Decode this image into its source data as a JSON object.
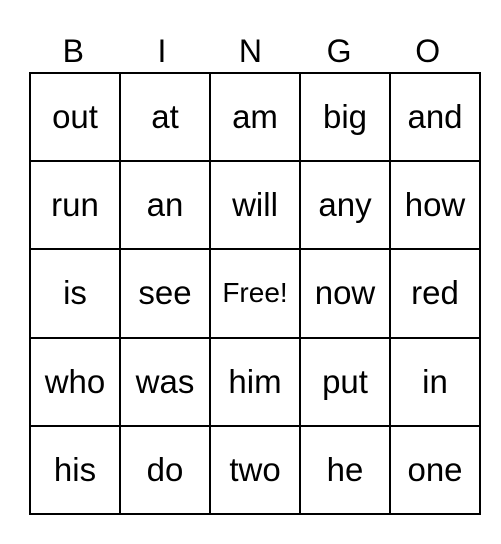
{
  "header": [
    "B",
    "I",
    "N",
    "G",
    "O"
  ],
  "rows": [
    [
      "out",
      "at",
      "am",
      "big",
      "and"
    ],
    [
      "run",
      "an",
      "will",
      "any",
      "how"
    ],
    [
      "is",
      "see",
      "Free!",
      "now",
      "red"
    ],
    [
      "who",
      "was",
      "him",
      "put",
      "in"
    ],
    [
      "his",
      "do",
      "two",
      "he",
      "one"
    ]
  ]
}
